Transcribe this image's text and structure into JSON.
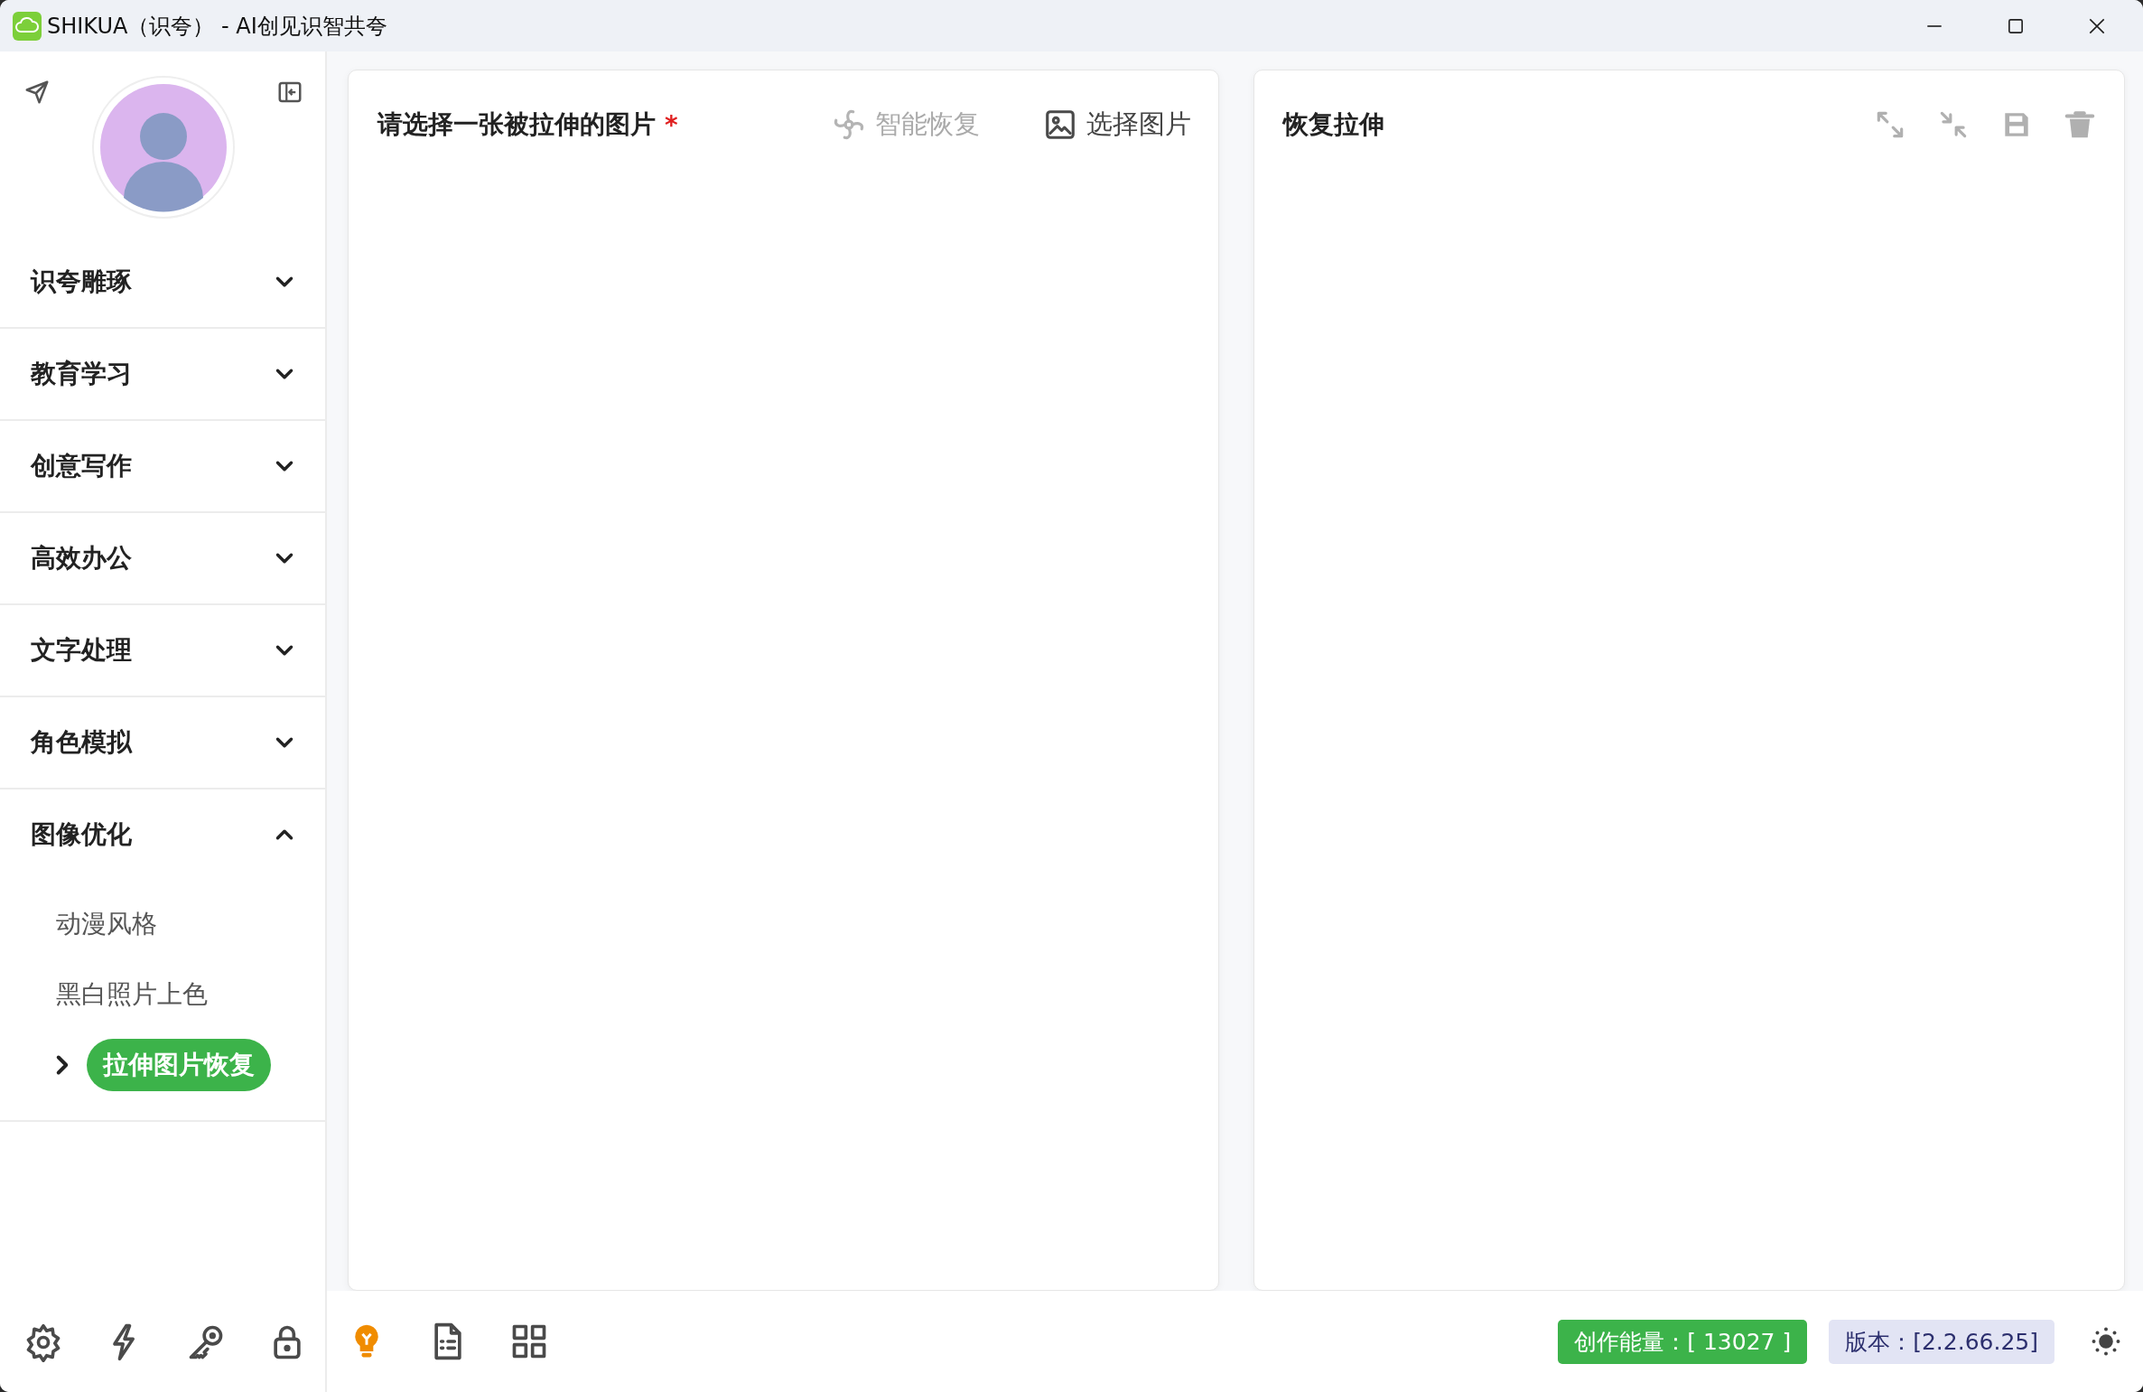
{
  "window": {
    "title": "SHIKUA（识夸） - AI创见识智共夸"
  },
  "sidebar": {
    "menu": [
      {
        "label": "识夸雕琢",
        "expanded": false
      },
      {
        "label": "教育学习",
        "expanded": false
      },
      {
        "label": "创意写作",
        "expanded": false
      },
      {
        "label": "高效办公",
        "expanded": false
      },
      {
        "label": "文字处理",
        "expanded": false
      },
      {
        "label": "角色模拟",
        "expanded": false
      },
      {
        "label": "图像优化",
        "expanded": true,
        "children": [
          {
            "label": "动漫风格",
            "selected": false
          },
          {
            "label": "黑白照片上色",
            "selected": false
          },
          {
            "label": "拉伸图片恢复",
            "selected": true
          }
        ]
      }
    ],
    "tools": [
      {
        "kind": "settings"
      },
      {
        "kind": "bolt"
      },
      {
        "kind": "key"
      },
      {
        "kind": "lock"
      }
    ]
  },
  "input_panel": {
    "title": "请选择一张被拉伸的图片",
    "required_mark": "*",
    "actions": [
      {
        "kind": "restore",
        "label": "智能恢复",
        "disabled": true
      },
      {
        "kind": "image",
        "label": "选择图片",
        "disabled": false
      }
    ]
  },
  "output_panel": {
    "title": "恢复拉伸",
    "actions": [
      {
        "kind": "expand",
        "disabled": true
      },
      {
        "kind": "shrink",
        "disabled": true
      },
      {
        "kind": "save",
        "disabled": true
      },
      {
        "kind": "delete",
        "disabled": true
      }
    ]
  },
  "bottom_bar": {
    "tools": [
      {
        "kind": "bulb"
      },
      {
        "kind": "document"
      },
      {
        "kind": "grid"
      }
    ],
    "energy": "创作能量：[ 13027 ]",
    "version": "版本：[2.2.66.25]"
  }
}
